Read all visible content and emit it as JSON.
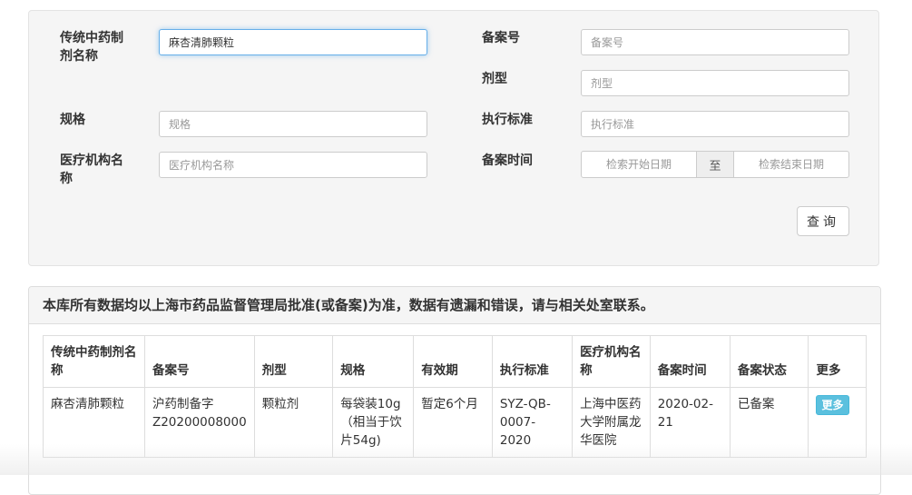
{
  "search": {
    "name_label": "传统中药制剂名称",
    "name_value": "麻杏清肺颗粒",
    "record_no_label": "备案号",
    "record_no_placeholder": "备案号",
    "dosage_form_label": "剂型",
    "dosage_form_placeholder": "剂型",
    "spec_label": "规格",
    "spec_placeholder": "规格",
    "standard_label": "执行标准",
    "standard_placeholder": "执行标准",
    "institution_label": "医疗机构名称",
    "institution_placeholder": "医疗机构名称",
    "record_time_label": "备案时间",
    "start_date_placeholder": "检索开始日期",
    "to_label": "至",
    "end_date_placeholder": "检索结束日期",
    "query_button": "查询"
  },
  "results": {
    "notice": "本库所有数据均以上海市药品监督管理局批准(或备案)为准，数据有遗漏和错误，请与相关处室联系。",
    "columns": [
      "传统中药制剂名称",
      "备案号",
      "剂型",
      "规格",
      "有效期",
      "执行标准",
      "医疗机构名称",
      "备案时间",
      "备案状态",
      "更多"
    ],
    "rows": [
      {
        "name": "麻杏清肺颗粒",
        "record_no": "沪药制备字Z20200008000",
        "dosage_form": "颗粒剂",
        "spec": "每袋装10g（相当于饮片54g)",
        "validity": "暂定6个月",
        "standard": "SYZ-QB-0007-2020",
        "institution": "上海中医药大学附属龙华医院",
        "record_time": "2020-02-21",
        "status": "已备案",
        "more": "更多"
      }
    ]
  },
  "colors": {
    "panel_bg": "#f5f5f5",
    "focus_border": "#66afe9",
    "more_button": "#5bc0de"
  }
}
